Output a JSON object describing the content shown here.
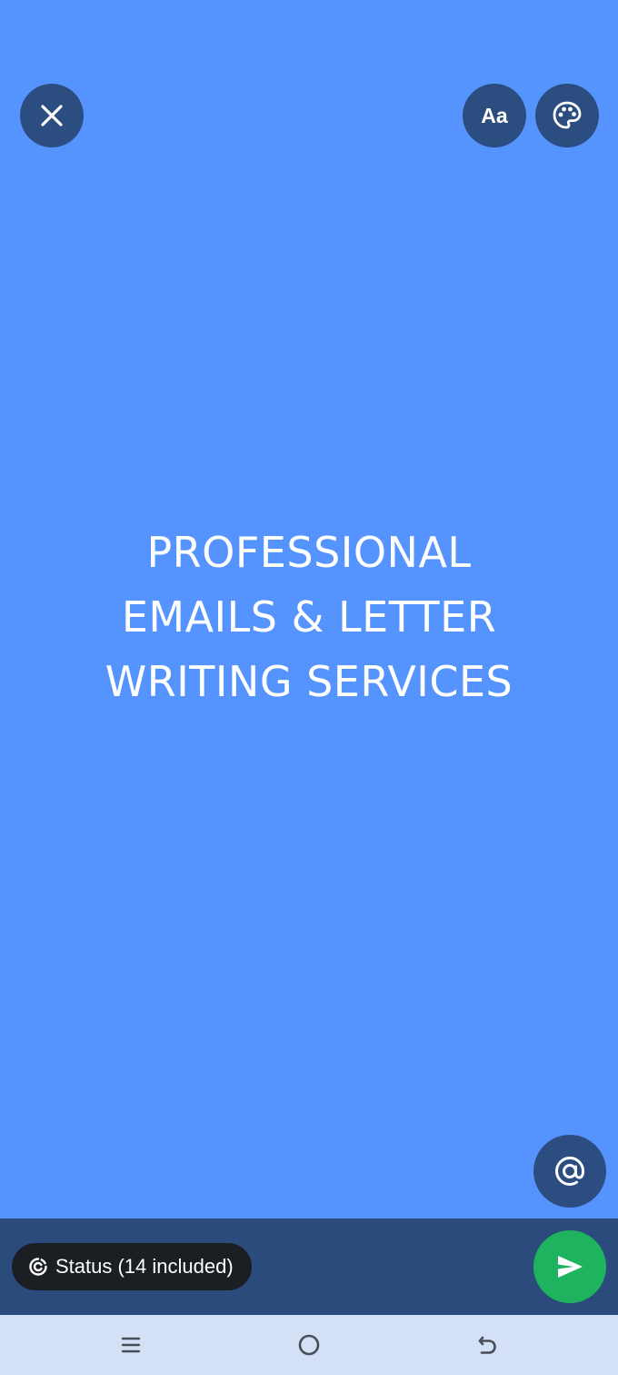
{
  "status_editor": {
    "text_lines": [
      "PROFESSIONAL",
      "EMAILS & LETTER",
      "WRITING SERVICES"
    ],
    "background_color": "#5594ff"
  },
  "toolbar": {
    "close_icon": "close-icon",
    "font_label": "Aa",
    "palette_icon": "palette-icon"
  },
  "mention_icon": "at-sign-icon",
  "bottom_bar": {
    "audience_label": "Status (14 included)",
    "audience_icon": "status-ring-icon",
    "send_icon": "send-icon",
    "send_color": "#20b35f"
  },
  "nav_bar": {
    "recents_icon": "recents-icon",
    "home_icon": "home-icon",
    "back_icon": "back-icon"
  }
}
